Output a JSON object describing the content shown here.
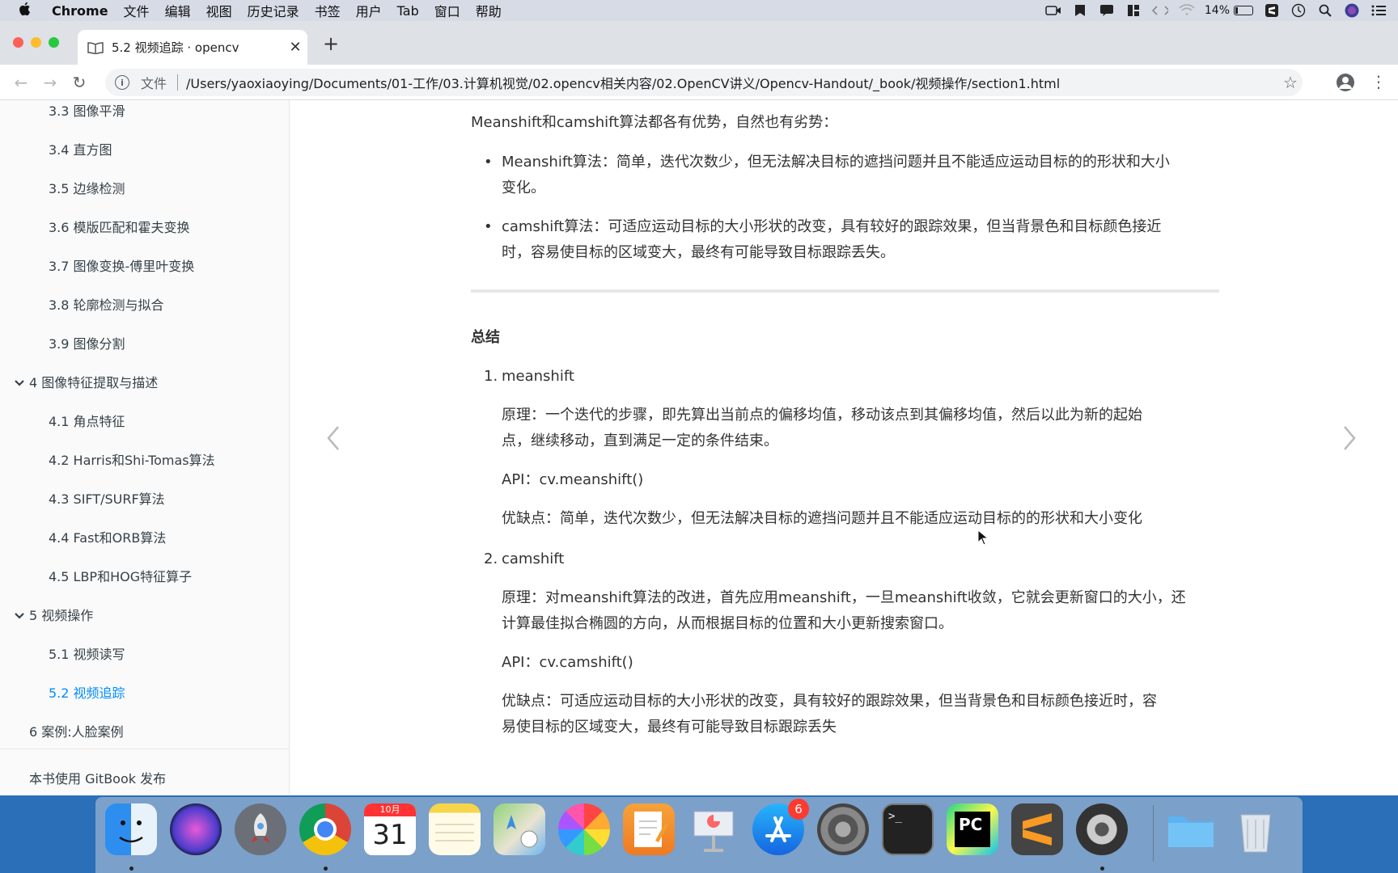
{
  "menubar": {
    "app_name": "Chrome",
    "items": [
      "文件",
      "编辑",
      "视图",
      "历史记录",
      "书签",
      "用户",
      "Tab",
      "窗口",
      "帮助"
    ],
    "battery_percent": "14%"
  },
  "browser": {
    "tab_title": "5.2 视频追踪 · opencv",
    "scheme_label": "文件",
    "url": "/Users/yaoxiaoying/Documents/01-工作/03.计算机视觉/02.opencv相关内容/02.OpenCV讲义/Opencv-Handout/_book/视频操作/section1.html"
  },
  "sidebar": {
    "items": [
      {
        "label": "3.3 图像平滑"
      },
      {
        "label": "3.4 直方图"
      },
      {
        "label": "3.5 边缘检测"
      },
      {
        "label": "3.6 模版匹配和霍夫变换"
      },
      {
        "label": "3.7 图像变换-傅里叶变换"
      },
      {
        "label": "3.8 轮廓检测与拟合"
      },
      {
        "label": "3.9 图像分割"
      },
      {
        "label": "4 图像特征提取与描述"
      },
      {
        "label": "4.1 角点特征"
      },
      {
        "label": "4.2 Harris和Shi-Tomas算法"
      },
      {
        "label": "4.3 SIFT/SURF算法"
      },
      {
        "label": "4.4 Fast和ORB算法"
      },
      {
        "label": "4.5 LBP和HOG特征算子"
      },
      {
        "label": "5 视频操作"
      },
      {
        "label": "5.1 视频读写"
      },
      {
        "label": "5.2 视频追踪"
      },
      {
        "label": "6 案例:人脸案例"
      }
    ],
    "footer": "本书使用 GitBook 发布"
  },
  "article": {
    "intro": "Meanshift和camshift算法都各有优势，自然也有劣势：",
    "bullets": [
      {
        "line1": "Meanshift算法：简单，迭代次数少，但无法解决目标的遮挡问题并且不能适应运动目标的的形状和大小",
        "line2": "变化。"
      },
      {
        "line1": "camshift算法：可适应运动目标的大小形状的改变，具有较好的跟踪效果，但当背景色和目标颜色接近",
        "line2": "时，容易使目标的区域变大，最终有可能导致目标跟踪丢失。"
      }
    ],
    "summary_heading": "总结",
    "ordered": [
      {
        "num": "1.",
        "title": "meanshift",
        "principle_l1": "原理：一个迭代的步骤，即先算出当前点的偏移均值，移动该点到其偏移均值，然后以此为新的起始",
        "principle_l2": "点，继续移动，直到满足一定的条件结束。",
        "api": "API：cv.meanshift()",
        "pros_l1": "优缺点：简单，迭代次数少，但无法解决目标的遮挡问题并且不能适应运动目标的的形状和大小变化",
        "pros_l2": ""
      },
      {
        "num": "2.",
        "title": "camshift",
        "principle_l1": "原理：对meanshift算法的改进，首先应用meanshift，一旦meanshift收敛，它就会更新窗口的大小，还",
        "principle_l2": "计算最佳拟合椭圆的方向，从而根据目标的位置和大小更新搜索窗口。",
        "api": "API：cv.camshift()",
        "pros_l1": "优缺点：可适应运动目标的大小形状的改变，具有较好的跟踪效果，但当背景色和目标颜色接近时，容",
        "pros_l2": "易使目标的区域变大，最终有可能导致目标跟踪丢失"
      }
    ]
  },
  "dock": {
    "calendar_month": "10月",
    "calendar_day": "31",
    "appstore_badge": "6",
    "apps": [
      "finder-icon",
      "siri-icon",
      "launchpad-icon",
      "chrome-icon",
      "calendar-icon",
      "notes-icon",
      "maps-icon",
      "photos-icon",
      "pages-icon",
      "keynote-icon",
      "app-store-icon",
      "system-preferences-icon",
      "terminal-icon",
      "pycharm-icon",
      "sublime-text-icon",
      "final-cut-icon",
      "folder-icon",
      "trash-icon"
    ]
  },
  "colors": {
    "active_link": "#008cff",
    "sidebar_text": "#364149",
    "body_text": "#333333"
  }
}
